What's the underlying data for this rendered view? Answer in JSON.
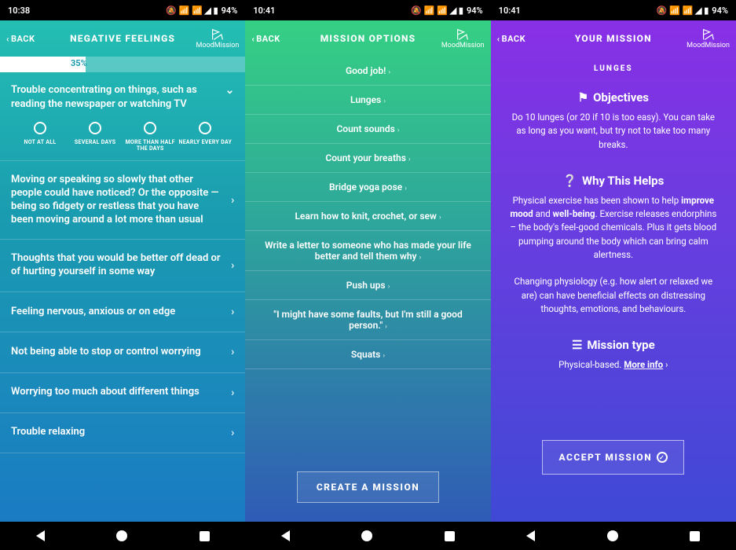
{
  "status": {
    "time1": "10:38",
    "time2": "10:41",
    "time3": "10:41",
    "battery": "94%",
    "icons": "🔕 📶 📶 ◢ ▮"
  },
  "brand": "MoodMission",
  "back_label": "BACK",
  "screen1": {
    "title": "NEGATIVE FEELINGS",
    "progress_pct": "35%",
    "expanded_question": "Trouble concentrating on things, such as reading the newspaper or watching TV",
    "options": [
      "NOT AT ALL",
      "SEVERAL DAYS",
      "MORE THAN HALF THE DAYS",
      "NEARLY EVERY DAY"
    ],
    "items": [
      "Moving or speaking so slowly that other people could have noticed? Or the opposite — being so fidgety or restless that you have been moving around a lot more than usual",
      "Thoughts that you would be better off dead or of hurting yourself in some way",
      "Feeling nervous, anxious or on edge",
      "Not being able to stop or control worrying",
      "Worrying too much about different things",
      "Trouble relaxing"
    ]
  },
  "screen2": {
    "title": "MISSION OPTIONS",
    "missions": [
      "Good job!",
      "Lunges",
      "Count sounds",
      "Count your breaths",
      "Bridge yoga pose",
      "Learn how to knit, crochet, or sew",
      "Write a letter to someone who has made your life better and tell them why",
      "Push ups",
      "\"I might have some faults, but I'm still a good person.\"",
      "Squats"
    ],
    "create_label": "CREATE A MISSION"
  },
  "screen3": {
    "title": "YOUR MISSION",
    "mission_name": "LUNGES",
    "objectives_title": "Objectives",
    "objectives_body": "Do 10 lunges (or 20 if 10 is too easy). You can take as long as you want, but try not to take too many breaks.",
    "why_title": "Why This Helps",
    "why_body1_pre": "Physical exercise has been shown to help ",
    "why_body1_b1": "improve mood",
    "why_body1_mid": " and ",
    "why_body1_b2": "well-being",
    "why_body1_post": ". Exercise releases endorphins – the body's feel-good chemicals. Plus it gets blood pumping around the body which can bring calm alertness.",
    "why_body2": "Changing physiology (e.g. how alert or relaxed we are) can have beneficial effects on distressing thoughts, emotions, and behaviours.",
    "type_title": "Mission type",
    "type_body": "Physical-based. ",
    "more_info": "More info",
    "accept_label": "ACCEPT MISSION"
  }
}
